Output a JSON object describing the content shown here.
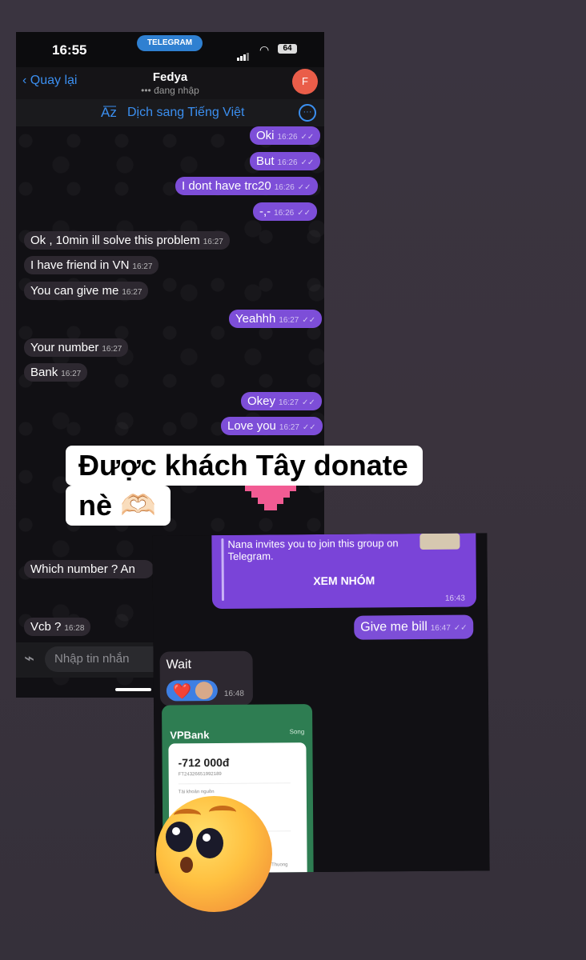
{
  "status_bar": {
    "time": "16:55",
    "app_pill": "TELEGRAM",
    "battery": "64"
  },
  "header": {
    "back_label": "Quay lại",
    "name": "Fedya",
    "status": "••• đang nhập",
    "avatar_letter": "F"
  },
  "translate_bar": {
    "icon": "translate-icon",
    "label": "Dịch sang Tiếng Việt",
    "more_icon": "ellipsis-icon"
  },
  "messages": [
    {
      "text": "Oki",
      "time": "16:26",
      "dir": "out"
    },
    {
      "text": "But",
      "time": "16:26",
      "dir": "out"
    },
    {
      "text": "I dont have trc20",
      "time": "16:26",
      "dir": "out"
    },
    {
      "text": "-,-",
      "time": "16:26",
      "dir": "out"
    },
    {
      "text": "Ok , 10min ill solve this problem",
      "time": "16:27",
      "dir": "in"
    },
    {
      "text": "I have friend in VN",
      "time": "16:27",
      "dir": "in"
    },
    {
      "text": "You can give me",
      "time": "16:27",
      "dir": "in"
    },
    {
      "text": "Yeahhh",
      "time": "16:27",
      "dir": "out"
    },
    {
      "text": "Your number",
      "time": "16:27",
      "dir": "in"
    },
    {
      "text": "Bank",
      "time": "16:27",
      "dir": "in"
    },
    {
      "text": "Okey",
      "time": "16:27",
      "dir": "out"
    },
    {
      "text": "Love you",
      "time": "16:27",
      "dir": "out"
    },
    {
      "text": "Which number ? An",
      "time": "",
      "dir": "in"
    },
    {
      "text": "Vcb ?",
      "time": "16:28",
      "dir": "in"
    }
  ],
  "input": {
    "placeholder": "Nhập tin nhắn",
    "attach_icon": "paperclip-icon"
  },
  "caption": {
    "line1": "Được khách Tây donate",
    "line2": "nè 🫶🏻"
  },
  "second_shot": {
    "invite_text": "Nana invites you to join this group on Telegram.",
    "invite_button": "XEM NHÓM",
    "invite_time": "16:43",
    "give_bill": {
      "text": "Give me bill",
      "time": "16:47"
    },
    "wait": {
      "text": "Wait",
      "time": "16:48",
      "reaction": "❤️"
    },
    "receipt": {
      "bank": "VPBank",
      "amount": "-712 000đ",
      "ref": "FT24326651992189",
      "label": "Tài khoản nguồn",
      "footer": "NH Ngoai Thuong"
    }
  },
  "emoji_sticker": "surprised-face-emoji",
  "colors": {
    "outgoing": "#7d4ed8",
    "incoming": "#2d2830",
    "accent": "#3b8ff0"
  }
}
